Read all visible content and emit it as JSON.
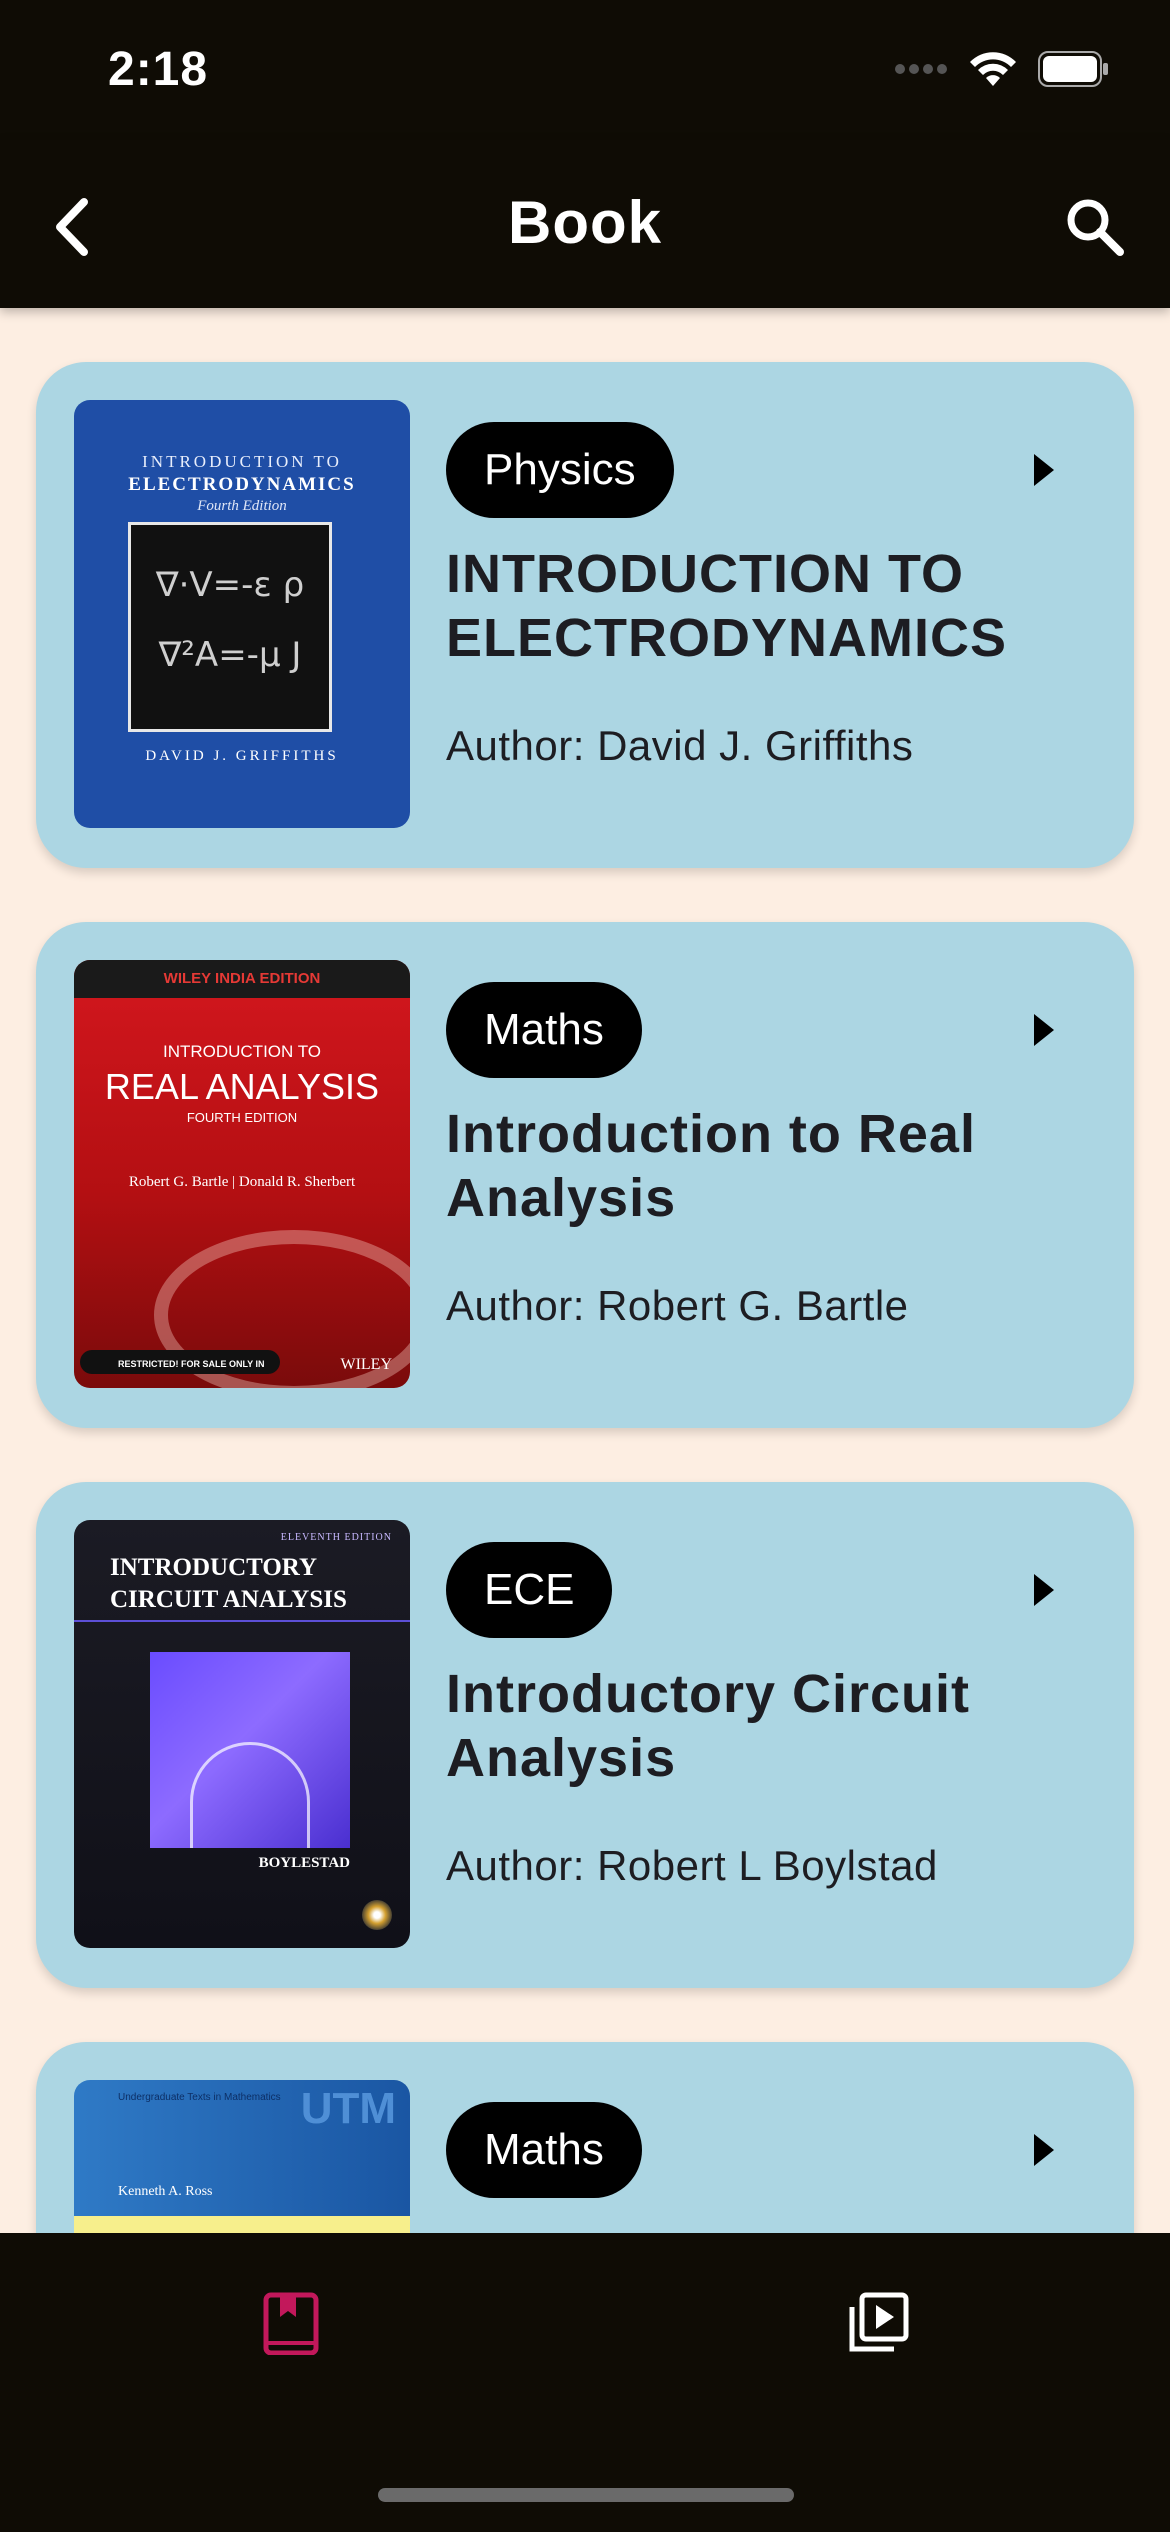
{
  "status_bar": {
    "time": "2:18"
  },
  "app_bar": {
    "title": "Book"
  },
  "books": [
    {
      "category": "Physics",
      "title": "INTRODUCTION TO ELECTRODYNAMICS",
      "author": "Author: David J. Griffiths",
      "cover": {
        "line1": "INTRODUCTION TO",
        "line2": "ELECTRODYNAMICS",
        "edition": "Fourth Edition",
        "eq1": "∇·V=-ε ρ",
        "eq2": "∇²A=-μ J",
        "author": "DAVID J. GRIFFITHS"
      }
    },
    {
      "category": "Maths",
      "title": "Introduction to Real Analysis",
      "author": "Author: Robert G. Bartle",
      "cover": {
        "banner": "WILEY INDIA EDITION",
        "line1": "INTRODUCTION TO",
        "line2": "REAL ANALYSIS",
        "edition": "FOURTH EDITION",
        "authors": "Robert G. Bartle | Donald R. Sherbert",
        "restricted": "RESTRICTED! FOR SALE ONLY IN",
        "publisher": "WILEY"
      }
    },
    {
      "category": "ECE",
      "title": "Introductory Circuit Analysis",
      "author": "Author: Robert L Boylstad",
      "cover": {
        "edition": "ELEVENTH EDITION",
        "line1": "INTRODUCTORY",
        "line2": "CIRCUIT ANALYSIS",
        "author": "BOYLESTAD"
      }
    },
    {
      "category": "Maths",
      "title": "",
      "author": "",
      "cover": {
        "series": "Undergraduate Texts in Mathematics",
        "logo": "UTM",
        "author": "Kenneth A. Ross"
      }
    }
  ],
  "bottom_nav": {
    "tabs": [
      {
        "icon": "book-icon",
        "active": true,
        "color": "#c2185b"
      },
      {
        "icon": "video-library-icon",
        "active": false,
        "color": "#ffffff"
      }
    ]
  }
}
